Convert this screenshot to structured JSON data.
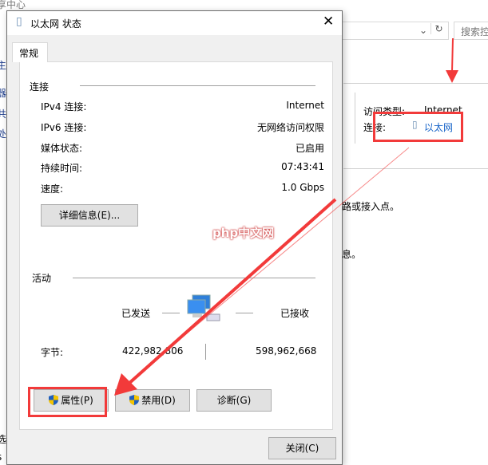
{
  "background": {
    "window_title_fragment": "享中心",
    "left_fragments": [
      "主",
      "器",
      "共",
      "处",
      "选",
      "s"
    ],
    "search_placeholder": "搜索控",
    "access_type_label": "访问类型:",
    "access_type_value": "Internet",
    "connection_label": "连接:",
    "connection_link": "以太网",
    "text_fragment_1": "路或接入点。",
    "text_fragment_2": "息。"
  },
  "dialog": {
    "title": "以太网 状态",
    "tab": "常规",
    "connection_section": "连接",
    "rows": [
      {
        "label": "IPv4 连接:",
        "value": "Internet"
      },
      {
        "label": "IPv6 连接:",
        "value": "无网络访问权限"
      },
      {
        "label": "媒体状态:",
        "value": "已启用"
      },
      {
        "label": "持续时间:",
        "value": "07:43:41"
      },
      {
        "label": "速度:",
        "value": "1.0 Gbps"
      }
    ],
    "details_button": "详细信息(E)...",
    "activity_section": "活动",
    "sent_label": "已发送",
    "received_label": "已接收",
    "bytes_label": "字节:",
    "bytes_sent": "422,982,806",
    "bytes_received": "598,962,668",
    "properties_button": "属性(P)",
    "disable_button": "禁用(D)",
    "diagnose_button": "诊断(G)",
    "close_button": "关闭(C)"
  },
  "watermark": "php中文网",
  "colors": {
    "annotation": "#f23a3a",
    "link": "#1a66c9"
  }
}
